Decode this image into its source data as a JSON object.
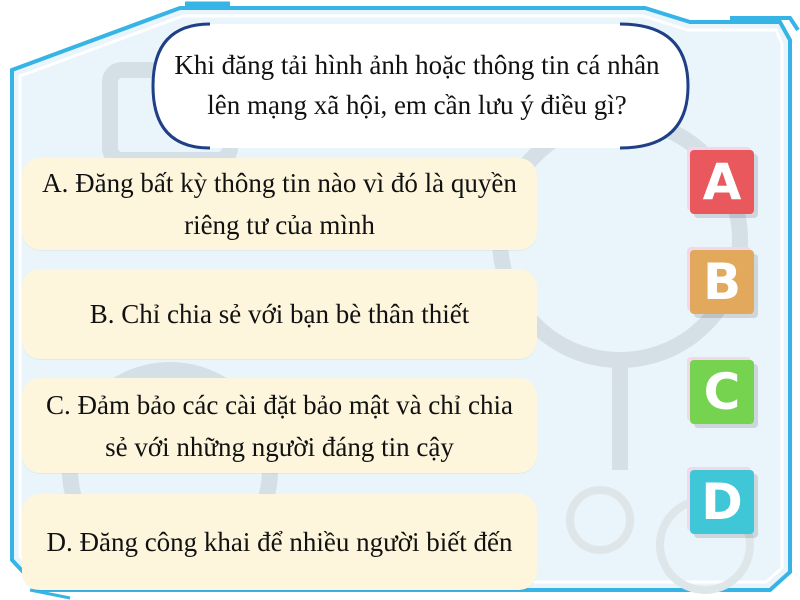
{
  "question": {
    "line1": "Khi đăng tải hình ảnh hoặc thông tin cá nhân",
    "line2": "lên mạng xã hội, em cần lưu ý điều gì?"
  },
  "answers": [
    {
      "letter": "A",
      "text": "A. Đăng bất kỳ thông tin nào vì đó là quyền riêng tư của mình",
      "color": "#e9585d"
    },
    {
      "letter": "B",
      "text": "B. Chỉ chia sẻ với bạn bè thân thiết",
      "color": "#e2a85c"
    },
    {
      "letter": "C",
      "text": "C. Đảm bảo các cài đặt bảo mật và chỉ chia sẻ với những người đáng tin cậy",
      "color": "#76d34f"
    },
    {
      "letter": "D",
      "text": "D. Đăng công khai để nhiều người biết đến",
      "color": "#3fc7d8"
    }
  ],
  "theme": {
    "frame_fill": "#e9f4fb",
    "frame_border": "#36b4e6",
    "card_fill": "#fdf6dd",
    "button_outline": "#e45bb6"
  }
}
